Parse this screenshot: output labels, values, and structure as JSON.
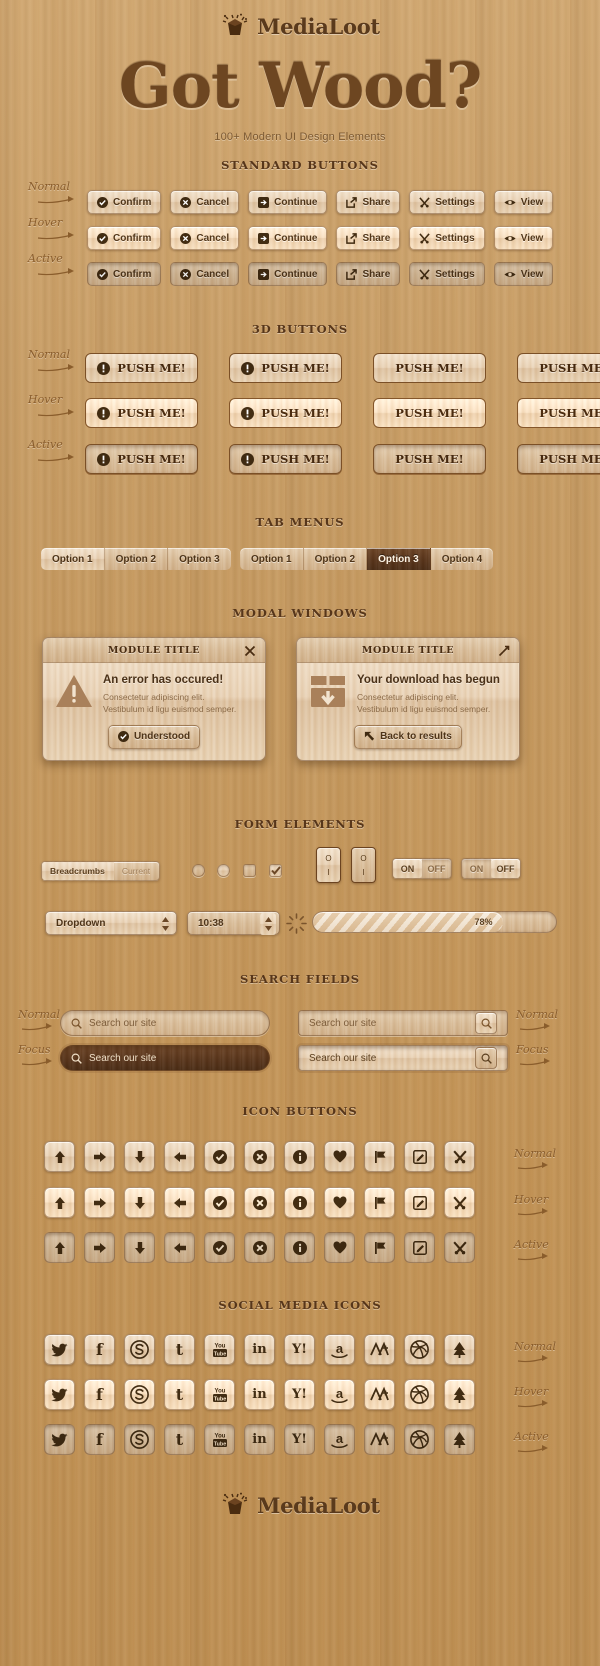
{
  "brand": {
    "name": "MediaLoot",
    "icon": "medialoot-logo-icon"
  },
  "hero": {
    "title": "Got Wood?",
    "subtitle": "100+ Modern UI Design Elements"
  },
  "states": {
    "normal": "Normal",
    "hover": "Hover",
    "active": "Active",
    "focus": "Focus"
  },
  "sections": {
    "standard_buttons": "STANDARD BUTTONS",
    "buttons_3d": "3D BUTTONS",
    "tab_menus": "TAB MENUS",
    "modal_windows": "MODAL WINDOWS",
    "form_elements": "FORM ELEMENTS",
    "search_fields": "SEARCH FIELDS",
    "icon_buttons": "ICON BUTTONS",
    "social_media_icons": "SOCIAL MEDIA ICONS"
  },
  "standard_buttons": {
    "items": [
      {
        "label": "Confirm",
        "icon": "check-circle-icon"
      },
      {
        "label": "Cancel",
        "icon": "x-circle-icon"
      },
      {
        "label": "Continue",
        "icon": "arrow-right-box-icon"
      },
      {
        "label": "Share",
        "icon": "share-icon"
      },
      {
        "label": "Settings",
        "icon": "tools-icon"
      },
      {
        "label": "View",
        "icon": "eye-icon"
      }
    ]
  },
  "buttons_3d": {
    "items": [
      {
        "label": "PUSH ME!",
        "icon": "exclamation-circle-icon"
      },
      {
        "label": "PUSH ME!",
        "icon": "exclamation-circle-icon"
      },
      {
        "label": "PUSH ME!",
        "icon": ""
      },
      {
        "label": "PUSH ME!",
        "icon": ""
      }
    ]
  },
  "tabs": {
    "left_group": [
      {
        "label": "Option 1",
        "active": true
      },
      {
        "label": "Option 2",
        "active": false
      },
      {
        "label": "Option 3",
        "active": false
      }
    ],
    "right_group": [
      {
        "label": "Option 1",
        "active": false
      },
      {
        "label": "Option 2",
        "active": false
      },
      {
        "label": "Option 3",
        "active": true
      },
      {
        "label": "Option 4",
        "active": false
      }
    ]
  },
  "modals": [
    {
      "title": "MODULE TITLE",
      "head_button": "close-icon",
      "icon": "warning-triangle-icon",
      "heading": "An error has occured!",
      "line1": "Consectetur adipiscing elit.",
      "line2": "Vestibulum id ligu euismod semper.",
      "button": {
        "label": "Understood",
        "icon": "check-circle-icon"
      }
    },
    {
      "title": "MODULE TITLE",
      "head_button": "expand-icon",
      "icon": "download-box-icon",
      "heading": "Your download has begun",
      "line1": "Consectetur adipiscing elit.",
      "line2": "Vestibulum id ligu euismod semper.",
      "button": {
        "label": "Back to results",
        "icon": "back-arrow-icon"
      }
    }
  ],
  "form": {
    "breadcrumbs": {
      "first": "Breadcrumbs",
      "current": "Current"
    },
    "toggles": [
      {
        "on": "ON",
        "off": "OFF",
        "selected": "ON"
      },
      {
        "on": "ON",
        "off": "OFF",
        "selected": "OFF"
      }
    ],
    "rocker_labels": {
      "top": "O",
      "bottom": "I"
    },
    "dropdown": {
      "value": "Dropdown",
      "icon": "updown-arrows-icon"
    },
    "stepper": {
      "value": "10:38",
      "icon": "updown-arrows-icon"
    },
    "spinner": "loading-spinner-icon",
    "progress": {
      "value": 78,
      "label": "78%"
    }
  },
  "search": {
    "placeholder": "Search our site",
    "icon": "search-icon",
    "fields": [
      {
        "style": "pill",
        "state": "Normal"
      },
      {
        "style": "square",
        "state": "Normal"
      },
      {
        "style": "pill",
        "state": "Focus"
      },
      {
        "style": "square",
        "state": "Focus"
      }
    ]
  },
  "icon_buttons": {
    "items": [
      "arrow-up-icon",
      "arrow-right-icon",
      "arrow-down-icon",
      "arrow-left-icon",
      "check-circle-icon",
      "x-circle-icon",
      "info-circle-icon",
      "heart-icon",
      "flag-icon",
      "edit-icon",
      "tools-icon"
    ]
  },
  "social_icons": {
    "items": [
      "twitter-icon",
      "facebook-icon",
      "skype-icon",
      "tumblr-icon",
      "youtube-icon",
      "linkedin-icon",
      "yahoo-icon",
      "amazon-icon",
      "addthis-icon",
      "dribbble-icon",
      "forrst-icon"
    ]
  },
  "footer": {
    "name": "MediaLoot",
    "icon": "medialoot-logo-icon"
  }
}
